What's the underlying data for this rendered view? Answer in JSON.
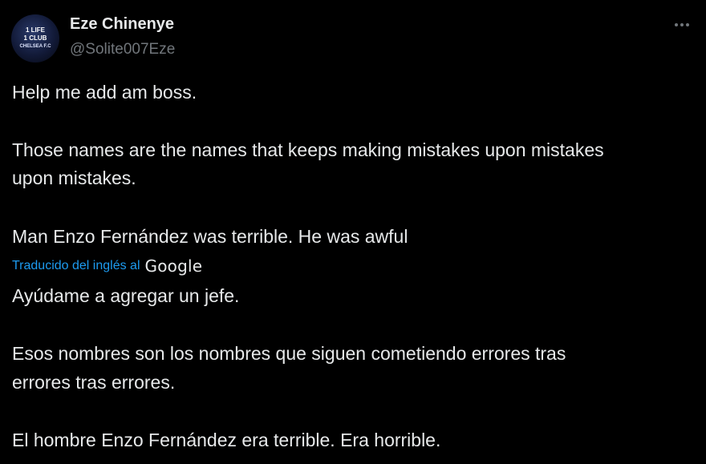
{
  "author": {
    "name": "Eze Chinenye",
    "handle": "@Solite007Eze",
    "avatar_text": [
      "1 LIFE",
      "1 CLUB",
      "CHELSEA F.C"
    ]
  },
  "menu": {
    "icon": "more-horizontal-icon"
  },
  "tweet": {
    "original": [
      "Help me add am boss.",
      "Those names are the names that keeps making mistakes upon mistakes",
      "upon mistakes.",
      "Man Enzo Fernández was terrible. He was awful"
    ],
    "translation_label": "Traducido del inglés al",
    "translation_provider": "Google",
    "translated": [
      "Ayúdame a agregar un jefe.",
      "Esos nombres son los nombres que siguen cometiendo errores tras",
      "errores tras errores.",
      "El hombre Enzo Fernández era terrible. Era horrible."
    ]
  },
  "colors": {
    "background": "#000000",
    "text": "#e7e9ea",
    "secondary": "#71767b",
    "link": "#1d9bf0"
  }
}
